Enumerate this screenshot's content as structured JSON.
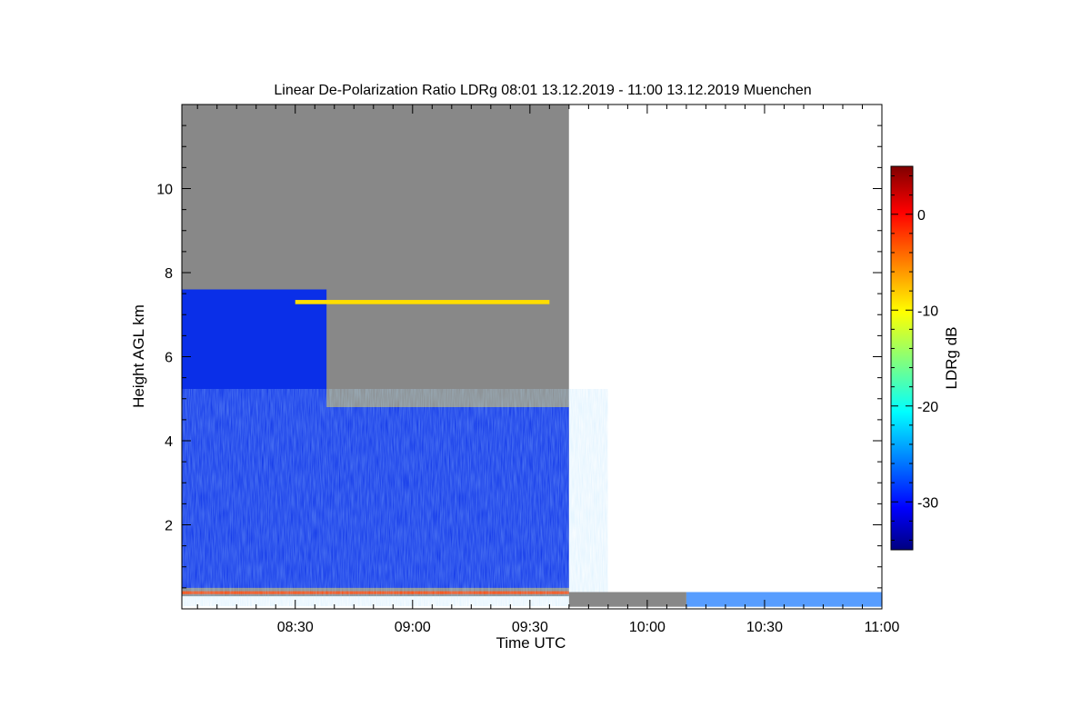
{
  "chart_data": {
    "type": "heatmap",
    "title": "Linear De-Polarization Ratio LDRg   08:01 13.12.2019 - 11:00 13.12.2019 Muenchen",
    "xlabel": "Time UTC",
    "ylabel": "Height AGL km",
    "x_ticks": [
      "08:30",
      "09:00",
      "09:30",
      "10:00",
      "10:30",
      "11:00"
    ],
    "y_ticks": [
      "2",
      "4",
      "6",
      "8",
      "10"
    ],
    "xlim": [
      "08:01",
      "11:00"
    ],
    "ylim": [
      0,
      12
    ],
    "colorbar": {
      "label": "LDRg dB",
      "ticks": [
        "0",
        "-10",
        "-20",
        "-30"
      ],
      "range": [
        -35,
        5
      ],
      "colormap": "jet"
    },
    "regions": [
      {
        "name": "no-signal",
        "color": "#888888",
        "t_start": "08:01",
        "t_end": "09:40",
        "h_bottom": 0.3,
        "h_top": 12
      },
      {
        "name": "low-level cloud LDR about -30 dB",
        "color": "#0a2fe8",
        "t_start": "08:01",
        "t_end": "09:40",
        "h_bottom": 0.5,
        "h_top": 4.8
      },
      {
        "name": "upper cloud layer",
        "color": "#0a2fe8",
        "t_start": "08:01",
        "t_end": "08:38",
        "h_bottom": 4.8,
        "h_top": 7.6
      },
      {
        "name": "layer near 7.3 km LDR about -10 dB",
        "color": "#ffdd00",
        "t_start": "08:30",
        "t_end": "09:35",
        "h_bottom": 7.25,
        "h_top": 7.35
      },
      {
        "name": "surface layer LDR about 0 dB",
        "color": "#ff4400",
        "t_start": "08:01",
        "t_end": "09:40",
        "h_bottom": 0.35,
        "h_top": 0.42
      },
      {
        "name": "no data",
        "color": "#ffffff",
        "t_start": "09:40",
        "t_end": "11:00",
        "h_bottom": 0.4,
        "h_top": 12
      }
    ]
  }
}
